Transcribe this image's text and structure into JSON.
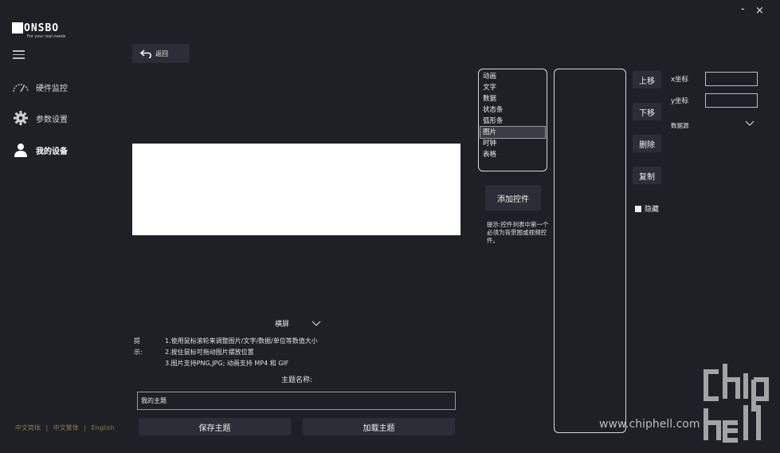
{
  "window": {
    "minimize": "-",
    "close": "×"
  },
  "logo": {
    "wordmark": "ONSBO",
    "tagline": "For your real needs"
  },
  "sidebar": {
    "items": [
      {
        "label": "硬件监控",
        "icon": "speedometer-icon"
      },
      {
        "label": "参数设置",
        "icon": "gear-icon"
      },
      {
        "label": "我的设备",
        "icon": "user-icon"
      }
    ]
  },
  "language": {
    "options": [
      "中文简体",
      "中文繁体",
      "English"
    ],
    "separator": "|"
  },
  "toolbar": {
    "back_label": "返回"
  },
  "orientation": {
    "selected": "横屏"
  },
  "tips": {
    "label": "提示:",
    "lines": [
      "1.使用鼠标滚轮来调整图片/文字/数据/单位等数值大小",
      "2.按住鼠标可拖动图片摆放位置",
      "3.图片支持PNG,JPG; 动画支持 MP4 和 GIF"
    ]
  },
  "theme": {
    "name_label": "主题名称:",
    "name_value": "我的主题",
    "save_label": "保存主题",
    "load_label": "加载主题"
  },
  "widget_types": [
    "动画",
    "文字",
    "数据",
    "状态条",
    "弧形条",
    "图片",
    "时钟",
    "表格"
  ],
  "selected_widget_type": "图片",
  "add_widget_label": "添加控件",
  "hint": "提示:控件列表中第一个必须为背景图或视频控件。",
  "actions": {
    "up": "上移",
    "down": "下移",
    "delete": "删除",
    "copy": "复制"
  },
  "hide_label": "隐藏",
  "coords": {
    "x_label": "x坐标",
    "y_label": "y坐标",
    "x_value": "",
    "y_value": ""
  },
  "datasource_label": "数据源",
  "watermark": {
    "site": "www.chiphell.com"
  }
}
